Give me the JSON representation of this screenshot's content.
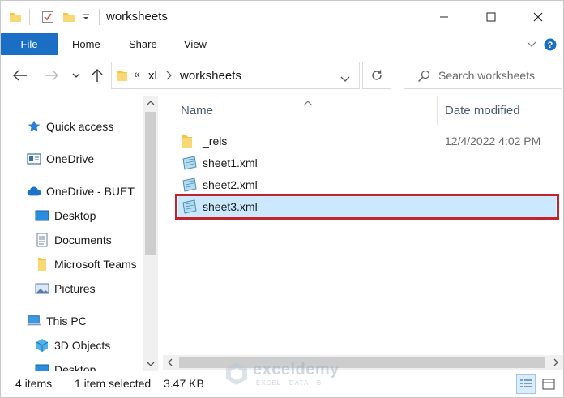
{
  "window": {
    "title": "worksheets"
  },
  "ribbon": {
    "tabs": [
      "File",
      "Home",
      "Share",
      "View"
    ]
  },
  "address": {
    "overflow": "«",
    "crumbs": [
      "xl",
      "worksheets"
    ]
  },
  "search": {
    "placeholder": "Search worksheets"
  },
  "navpane": {
    "items": [
      {
        "label": "Quick access",
        "icon": "star-icon"
      },
      {
        "label": "OneDrive",
        "icon": "onedrive-icon"
      },
      {
        "label": "OneDrive - BUET",
        "icon": "cloud-icon"
      },
      {
        "label": "Desktop",
        "icon": "desktop-icon"
      },
      {
        "label": "Documents",
        "icon": "documents-icon"
      },
      {
        "label": "Microsoft Teams",
        "icon": "folder-icon"
      },
      {
        "label": "Pictures",
        "icon": "pictures-icon"
      },
      {
        "label": "This PC",
        "icon": "computer-icon"
      },
      {
        "label": "3D Objects",
        "icon": "cube-icon"
      },
      {
        "label": "Desktop",
        "icon": "desktop-icon"
      }
    ]
  },
  "content": {
    "columns": [
      "Name",
      "Date modified"
    ],
    "files": [
      {
        "name": "_rels",
        "date": "12/4/2022 4:02 PM",
        "type": "folder"
      },
      {
        "name": "sheet1.xml",
        "date": "",
        "type": "xml"
      },
      {
        "name": "sheet2.xml",
        "date": "",
        "type": "xml"
      },
      {
        "name": "sheet3.xml",
        "date": "",
        "type": "xml",
        "selected": true
      }
    ]
  },
  "status": {
    "count": "4 items",
    "selected": "1 item selected",
    "size": "3.47 KB"
  },
  "watermark": {
    "title": "exceldemy",
    "subtitle": "EXCEL · DATA · BI"
  },
  "colors": {
    "accent": "#1a6fc4",
    "selection": "#cce8ff",
    "highlight": "#c4232b",
    "folder": "#f5c542"
  }
}
